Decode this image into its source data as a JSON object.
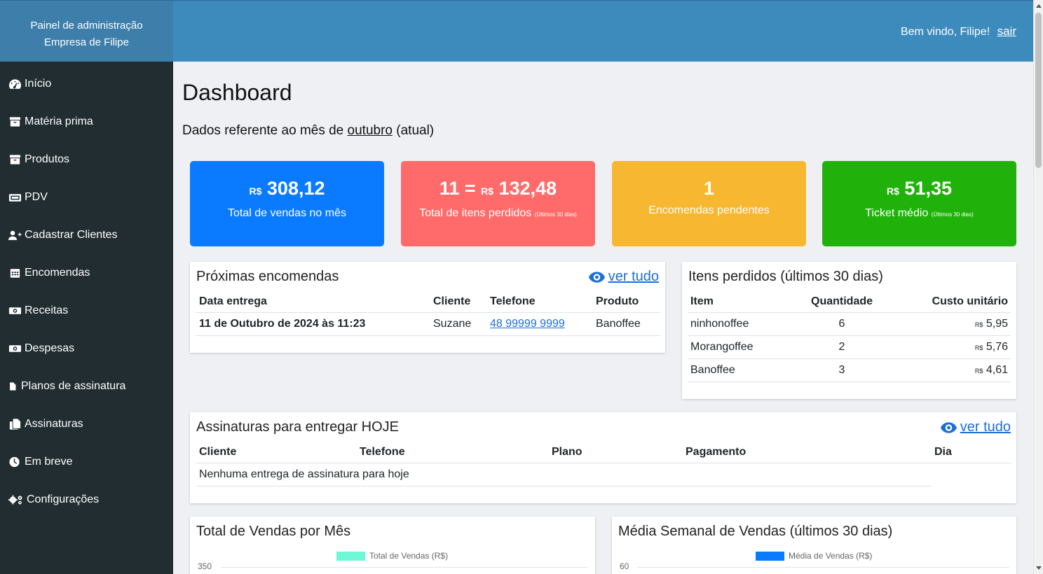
{
  "header": {
    "panel_title": "Painel de administração",
    "company": "Empresa de Filipe",
    "welcome": "Bem vindo, Filipe!",
    "logout": "sair"
  },
  "sidebar": {
    "items": [
      {
        "label": "Início",
        "icon": "gauge-icon"
      },
      {
        "label": "Matéria prima",
        "icon": "box-icon"
      },
      {
        "label": "Produtos",
        "icon": "box-icon"
      },
      {
        "label": "PDV",
        "icon": "cash-register-icon"
      },
      {
        "label": "Cadastrar Clientes",
        "icon": "user-plus-icon"
      },
      {
        "label": "Encomendas",
        "icon": "calendar-icon"
      },
      {
        "label": "Receitas",
        "icon": "money-bill-icon"
      },
      {
        "label": "Despesas",
        "icon": "money-bill-icon"
      },
      {
        "label": "Planos de assinatura",
        "icon": "file-icon"
      },
      {
        "label": "Assinaturas",
        "icon": "copy-icon"
      },
      {
        "label": "Em breve",
        "icon": "clock-icon"
      },
      {
        "label": "Configurações",
        "icon": "cogs-icon"
      }
    ]
  },
  "main": {
    "title": "Dashboard",
    "subtitle_prefix": "Dados referente ao mês de",
    "subtitle_month": "outubro",
    "subtitle_suffix": "(atual)"
  },
  "stats": [
    {
      "currency": "R$",
      "prefix": "",
      "value": "308,12",
      "label": "Total de vendas no mês",
      "note": "",
      "color": "#0a7bff"
    },
    {
      "currency": "R$",
      "prefix": "11 =",
      "value": "132,48",
      "label": "Total de itens perdidos",
      "note": "(Últimos 30 dias)",
      "color": "#ff6b6b"
    },
    {
      "currency": "",
      "prefix": "",
      "value": "1",
      "label": "Encomendas pendentes",
      "note": "",
      "color": "#f7b731"
    },
    {
      "currency": "R$",
      "prefix": "",
      "value": "51,35",
      "label": "Ticket médio",
      "note": "(Últimos 30 dias)",
      "color": "#20b20a"
    }
  ],
  "orders": {
    "title": "Próximas encomendas",
    "see_all": "ver tudo",
    "columns": [
      "Data entrega",
      "Cliente",
      "Telefone",
      "Produto"
    ],
    "rows": [
      {
        "date": "11 de Outubro de 2024 às 11:23",
        "client": "Suzane",
        "phone": "48 99999 9999",
        "product": "Banoffee"
      }
    ]
  },
  "lost_items": {
    "title": "Itens perdidos (últimos 30 dias)",
    "columns": [
      "Item",
      "Quantidade",
      "Custo unitário"
    ],
    "currency": "R$",
    "rows": [
      {
        "item": "ninhonoffee",
        "qty": "6",
        "cost": "5,95"
      },
      {
        "item": "Morangoffee",
        "qty": "2",
        "cost": "5,76"
      },
      {
        "item": "Banoffee",
        "qty": "3",
        "cost": "4,61"
      }
    ]
  },
  "subscriptions": {
    "title": "Assinaturas para entregar HOJE",
    "see_all": "ver tudo",
    "columns": [
      "Cliente",
      "Telefone",
      "Plano",
      "Pagamento",
      "Dia"
    ],
    "empty": "Nenhuma entrega de assinatura para hoje"
  },
  "charts": [
    {
      "title": "Total de Vendas por Mês",
      "legend": "Total de Vendas (R$)",
      "color": "#6ff7d8",
      "y_top": "350"
    },
    {
      "title": "Média Semanal de Vendas (últimos 30 dias)",
      "legend": "Média de Vendas (R$)",
      "color": "#0a7bff",
      "y_top": "60"
    }
  ]
}
